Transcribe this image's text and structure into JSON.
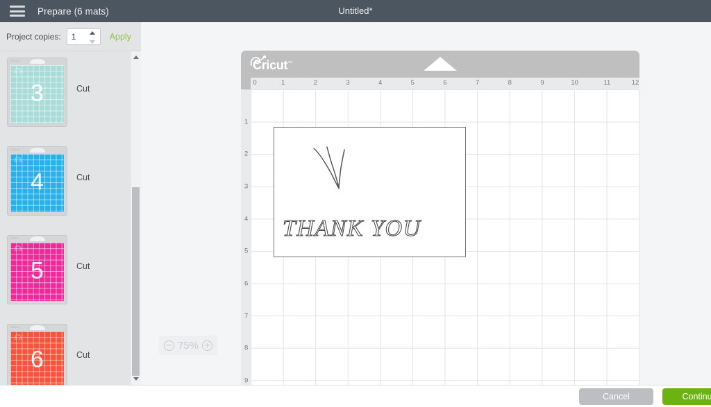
{
  "topbar": {
    "menu_icon": "hamburger-icon",
    "screen_title": "Prepare (6 mats)",
    "document_title": "Untitled*"
  },
  "left_panel": {
    "copies_label": "Project copies:",
    "copies_value": "1",
    "copies_placeholder": "1",
    "apply_label": "Apply",
    "mats": [
      {
        "number": "3",
        "operation": "Cut",
        "color": "#a9dcd8",
        "brand": "Cricut",
        "shape_icon": "elephant-icon"
      },
      {
        "number": "4",
        "operation": "Cut",
        "color": "#29b0e8",
        "brand": "Cricut",
        "shape_icon": "balloon-icon"
      },
      {
        "number": "5",
        "operation": "Cut",
        "color": "#ed2a9a",
        "brand": "Cricut",
        "shape_icon": "shape-icon"
      },
      {
        "number": "6",
        "operation": "Cut",
        "color": "#f4543c",
        "brand": "Cricut",
        "shape_icon": "shape-icon"
      }
    ]
  },
  "canvas": {
    "zoom": {
      "level": "75%",
      "zoom_out_icon": "minus-circle-icon",
      "zoom_in_icon": "plus-circle-icon"
    },
    "mat": {
      "logo_text": "Cricut",
      "logo_tm": "™",
      "ruler_horizontal": [
        "0",
        "1",
        "2",
        "3",
        "4",
        "5",
        "6",
        "7",
        "8",
        "9",
        "10",
        "11",
        "12"
      ],
      "ruler_vertical": [
        "1",
        "2",
        "3",
        "4",
        "5",
        "6",
        "7",
        "8",
        "9"
      ],
      "design": {
        "text": "THANK YOU",
        "decoration": "three-stem-flourish"
      }
    }
  },
  "bottombar": {
    "cancel_label": "Cancel",
    "continue_label": "Continue"
  },
  "colors": {
    "topbar_bg": "#4b5660",
    "accent_green": "#6cb312",
    "apply_green": "#8bc53f",
    "mat_board": "#bfbfbf",
    "panel_bg": "#e3e4e6"
  }
}
